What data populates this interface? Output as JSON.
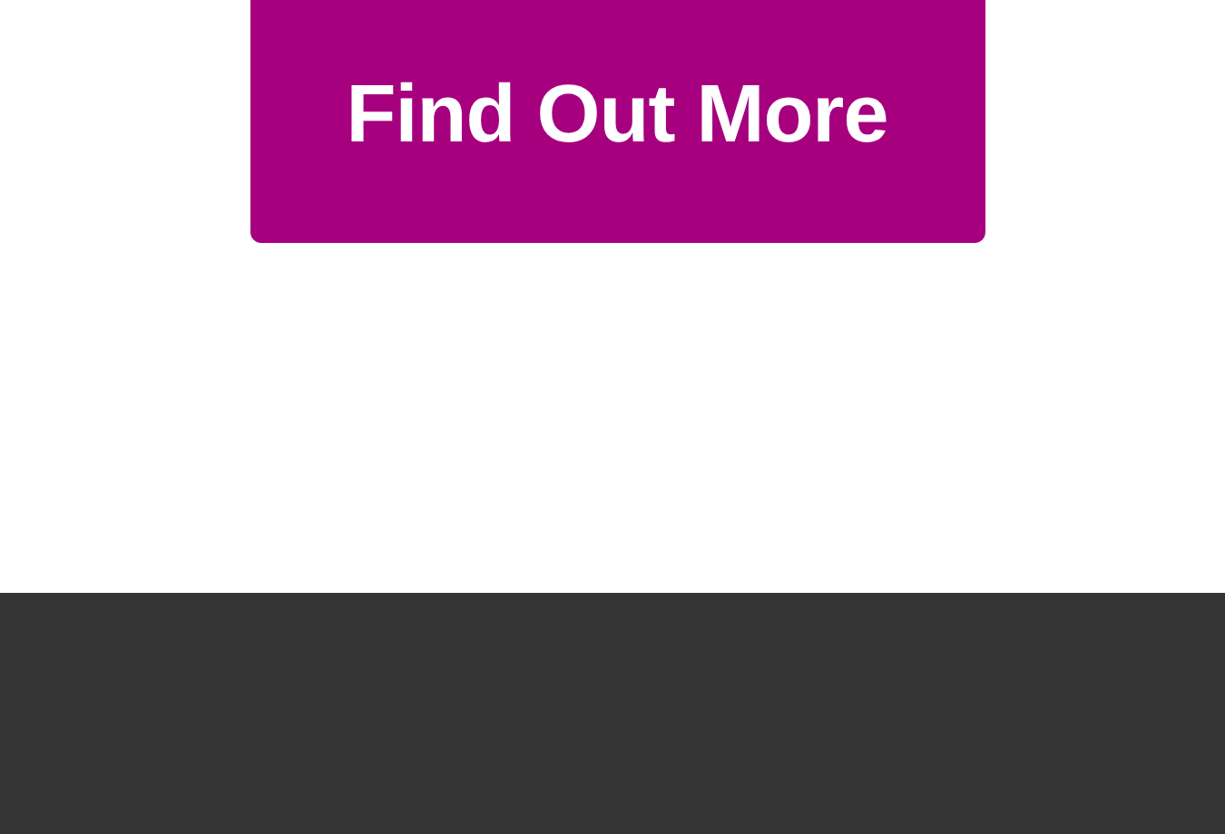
{
  "cta_button": {
    "label": "Find Out More"
  }
}
